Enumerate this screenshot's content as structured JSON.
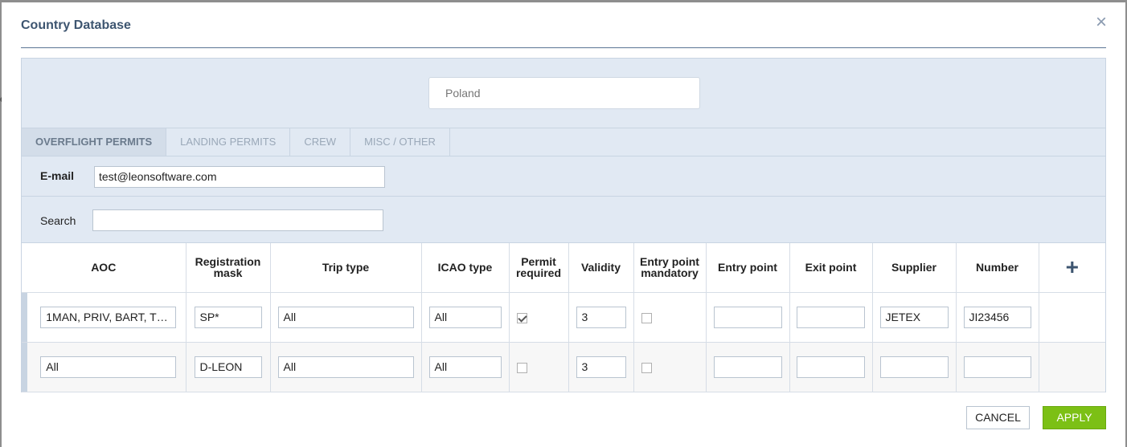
{
  "dialog": {
    "title": "Country Database",
    "close_glyph": "×"
  },
  "country": {
    "value": "Poland"
  },
  "tabs": [
    {
      "label": "OVERFLIGHT PERMITS",
      "active": true
    },
    {
      "label": "LANDING PERMITS",
      "active": false
    },
    {
      "label": "CREW",
      "active": false
    },
    {
      "label": "MISC / OTHER",
      "active": false
    }
  ],
  "email": {
    "label": "E-mail",
    "value": "test@leonsoftware.com"
  },
  "search": {
    "label": "Search",
    "value": ""
  },
  "table": {
    "columns": [
      "AOC",
      "Registration mask",
      "Trip type",
      "ICAO type",
      "Permit required",
      "Validity",
      "Entry point mandatory",
      "Entry point",
      "Exit point",
      "Supplier",
      "Number"
    ],
    "add_icon": "+",
    "rows": [
      {
        "aoc": "1MAN, PRIV, BART, TR...",
        "registration_mask": "SP*",
        "trip_type": "All",
        "icao_type": "All",
        "permit_required": true,
        "validity": "3",
        "entry_point_mandatory": false,
        "entry_point": "",
        "exit_point": "",
        "supplier": "JETEX",
        "number": "JI23456"
      },
      {
        "aoc": "All",
        "registration_mask": "D-LEON",
        "trip_type": "All",
        "icao_type": "All",
        "permit_required": false,
        "validity": "3",
        "entry_point_mandatory": false,
        "entry_point": "",
        "exit_point": "",
        "supplier": "",
        "number": ""
      }
    ]
  },
  "footer": {
    "cancel_label": "CANCEL",
    "apply_label": "APPLY"
  },
  "colors": {
    "accent": "#3d5570",
    "apply": "#7cc015",
    "panel_bg": "#e1e9f3"
  }
}
